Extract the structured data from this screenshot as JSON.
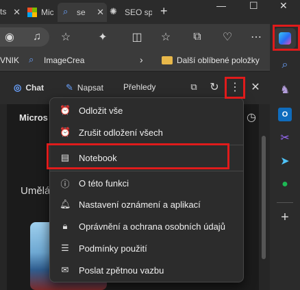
{
  "tabs": [
    {
      "label": "Microsoft Start",
      "icon": "microsoft-icon"
    },
    {
      "label": "se",
      "icon": "search-icon"
    },
    {
      "label": "SEO sp",
      "icon": "chatgpt-icon"
    }
  ],
  "favorites": {
    "item1": "VNIK",
    "item2": "ImageCrea",
    "folder": "Další oblíbené položky"
  },
  "sidepane": {
    "tabs": {
      "chat": "Chat",
      "compose": "Napsat",
      "insights": "Přehledy"
    },
    "header_text": "Micros",
    "body_text": "Umělá"
  },
  "menu": {
    "items": [
      {
        "label": "Odložit vše",
        "icon": "snooze-icon"
      },
      {
        "label": "Zrušit odložení všech",
        "icon": "unsnooze-icon"
      },
      {
        "label": "Notebook",
        "icon": "notebook-icon"
      },
      {
        "label": "O této funkci",
        "icon": "info-icon"
      },
      {
        "label": "Nastavení oznámení a aplikací",
        "icon": "bell-icon"
      },
      {
        "label": "Oprávnění a ochrana osobních údajů",
        "icon": "lock-icon"
      },
      {
        "label": "Podmínky použití",
        "icon": "list-icon"
      },
      {
        "label": "Poslat zpětnou vazbu",
        "icon": "feedback-icon"
      }
    ]
  },
  "highlight_color": "#e01b1b",
  "accent": "#6aa2ff"
}
